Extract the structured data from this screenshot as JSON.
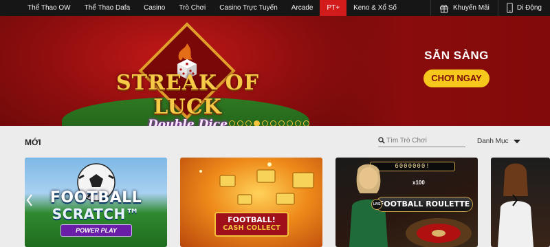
{
  "nav": {
    "items": [
      {
        "label": "Thể Thao OW",
        "active": false
      },
      {
        "label": "Thể Thao Dafa",
        "active": false
      },
      {
        "label": "Casino",
        "active": false
      },
      {
        "label": "Trò Chơi",
        "active": false
      },
      {
        "label": "Casino Trực Tuyến",
        "active": false
      },
      {
        "label": "Arcade",
        "active": false
      },
      {
        "label": "PT+",
        "active": true
      },
      {
        "label": "Keno & Xổ Số",
        "active": false
      }
    ],
    "promotions": {
      "label": "Khuyến Mãi",
      "icon": "gift-icon"
    },
    "mobile": {
      "label": "Di Động",
      "icon": "mobile-phone-icon"
    }
  },
  "hero": {
    "logo_main": "STREAK OF LUCK",
    "logo_sub": "Double Dice",
    "cta_title": "SẴN SÀNG",
    "cta_button": "CHƠI NGAY",
    "slides_total": 10,
    "slide_active": 3
  },
  "section": {
    "title": "MỚI",
    "search_placeholder": "Tìm Trò Chơi",
    "filter_label": "Danh Mục"
  },
  "games": [
    {
      "title_line1": "FOOTBALL",
      "title_line2": "SCRATCH™",
      "badge": "POWER PLAY"
    },
    {
      "title_line1": "FOOTBALL!",
      "title_line2": "CASH COLLECT"
    },
    {
      "title": "FOOTBALL ROULETTE",
      "top_display": "6000000!",
      "multiplier": "x100",
      "badge": "LIVE"
    },
    {
      "title": ""
    }
  ],
  "colors": {
    "nav_bg": "#161616",
    "nav_active": "#d21c1c",
    "cta_button_bg": "#f6c81b",
    "dot_color": "#f3c23c"
  }
}
